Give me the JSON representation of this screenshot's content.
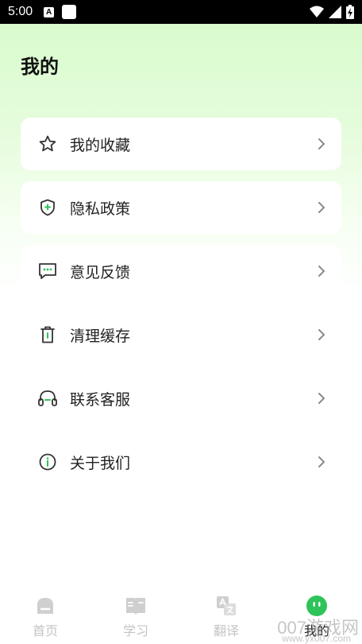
{
  "status_bar": {
    "time": "5:00",
    "notification_icon_letter": "A"
  },
  "header": {
    "title": "我的"
  },
  "menu": {
    "items": [
      {
        "label": "我的收藏",
        "icon": "star-icon"
      },
      {
        "label": "隐私政策",
        "icon": "shield-icon"
      },
      {
        "label": "意见反馈",
        "icon": "message-icon"
      },
      {
        "label": "清理缓存",
        "icon": "trash-icon"
      },
      {
        "label": "联系客服",
        "icon": "headset-icon"
      },
      {
        "label": "关于我们",
        "icon": "info-icon"
      }
    ]
  },
  "tabbar": {
    "tabs": [
      {
        "label": "首页",
        "icon": "home-icon",
        "active": false
      },
      {
        "label": "学习",
        "icon": "book-icon",
        "active": false
      },
      {
        "label": "翻译",
        "icon": "translate-icon",
        "active": false
      },
      {
        "label": "我的",
        "icon": "profile-icon",
        "active": true
      }
    ]
  },
  "watermark": {
    "text": "007游戏网",
    "sub": "www.yx007.com"
  },
  "colors": {
    "accent": "#2ec45a",
    "header_gradient": "#d6fbcb",
    "chevron": "#8a8a8a",
    "icon": "#333333"
  }
}
